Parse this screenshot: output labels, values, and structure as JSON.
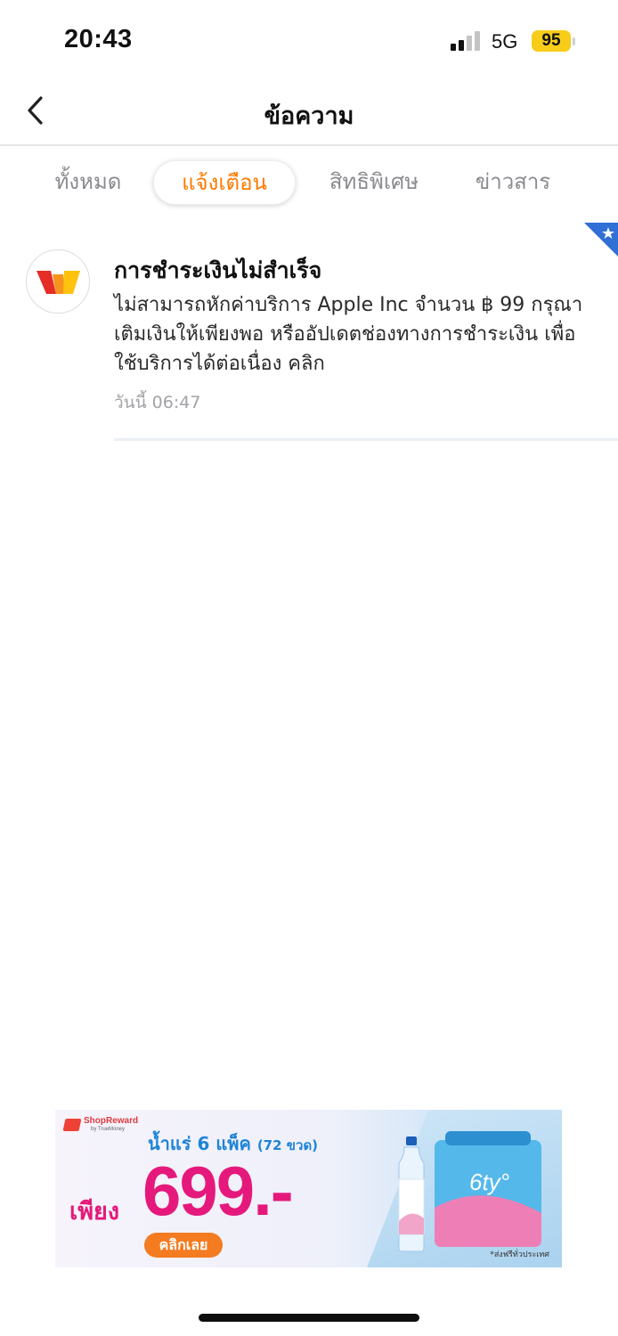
{
  "status_bar": {
    "time": "20:43",
    "network": "5G",
    "battery": "95"
  },
  "header": {
    "title": "ข้อความ",
    "back_icon": "chevron-left-icon"
  },
  "tabs": [
    {
      "label": "ทั้งหมด",
      "active": false
    },
    {
      "label": "แจ้งเตือน",
      "active": true
    },
    {
      "label": "สิทธิพิเศษ",
      "active": false
    },
    {
      "label": "ข่าวสาร",
      "active": false
    }
  ],
  "notification": {
    "title": "การชำระเงินไม่สำเร็จ",
    "body": "ไม่สามารถหักค่าบริการ Apple Inc จำนวน ฿ 99 กรุณาเติมเงินให้เพียงพอ หรืออัปเดตช่องทางการชำระเงิน เพื่อใช้บริการได้ต่อเนื่อง คลิก",
    "time": "วันนี้ 06:47",
    "avatar_icon": "truemoney-logo-icon",
    "badge_icon": "star-icon"
  },
  "ad": {
    "logo_text": "ShopReward",
    "logo_sub": "by TrueMoney",
    "headline": "น้ำแร่ 6 แพ็ค",
    "headline_small": "(72 ขวด)",
    "prefix": "เพียง",
    "price": "699.-",
    "cta": "คลิกเลย",
    "note": "*ส่งฟรีทั่วประเทศ",
    "brand": "6ty°"
  },
  "colors": {
    "accent": "#ff7a00",
    "price": "#e5197b",
    "headline": "#1e84d6",
    "badge": "#2f6fd6"
  }
}
